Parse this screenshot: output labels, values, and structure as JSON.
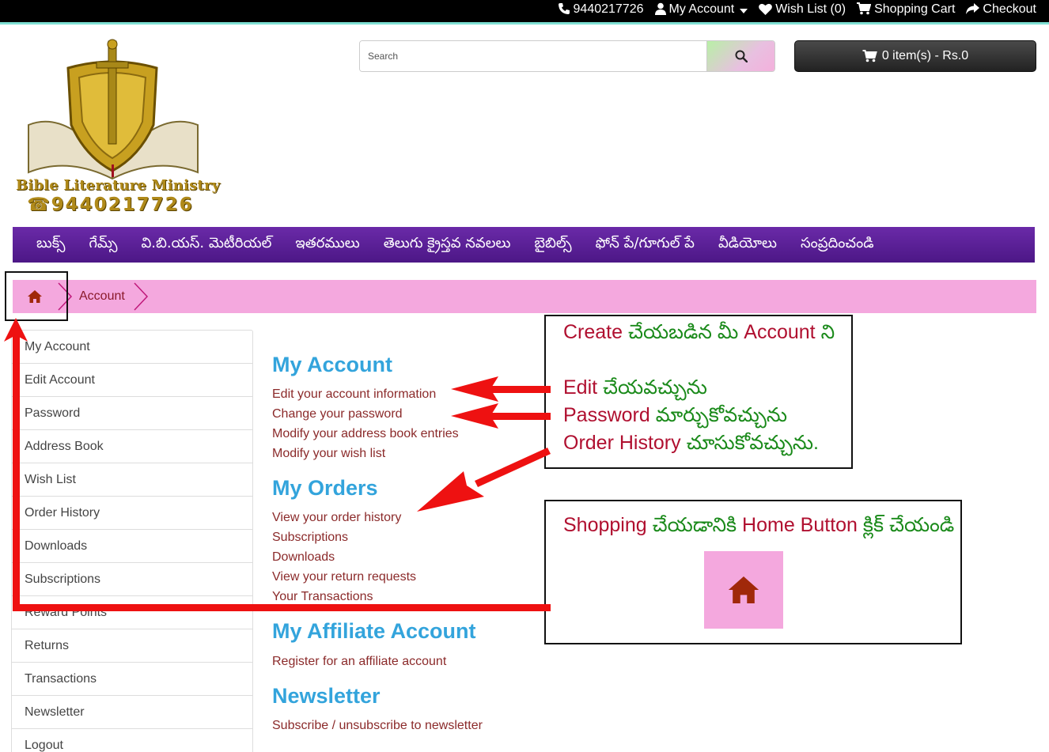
{
  "topbar": {
    "phone": "9440217726",
    "my_account": "My Account",
    "wish_list": "Wish List (0)",
    "shopping_cart": "Shopping Cart",
    "checkout": "Checkout"
  },
  "logo": {
    "name": "Bible Literature Ministry",
    "phone": "☎9440217726"
  },
  "search": {
    "placeholder": "Search"
  },
  "cart": {
    "label": "0 item(s) - Rs.0"
  },
  "menu": [
    "బుక్స్",
    "గేమ్స్",
    "వి.బి.యస్. మెటీరియల్",
    "ఇతరములు",
    "తెలుగు క్రైస్తవ నవలలు",
    "బైబిల్స్",
    "ఫోన్ పే/గూగుల్ పే",
    "వీడియోలు",
    "సంప్రదించండి"
  ],
  "breadcrumb": {
    "current": "Account"
  },
  "sidebar": [
    "My Account",
    "Edit Account",
    "Password",
    "Address Book",
    "Wish List",
    "Order History",
    "Downloads",
    "Subscriptions",
    "Reward Points",
    "Returns",
    "Transactions",
    "Newsletter",
    "Logout"
  ],
  "content": {
    "my_account": {
      "title": "My Account",
      "links": [
        "Edit your account information",
        "Change your password",
        "Modify your address book entries",
        "Modify your wish list"
      ]
    },
    "my_orders": {
      "title": "My Orders",
      "links": [
        "View your order history",
        "Subscriptions",
        "Downloads",
        "View your return requests",
        "Your Transactions"
      ]
    },
    "affiliate": {
      "title": "My Affiliate Account",
      "links": [
        "Register for an affiliate account"
      ]
    },
    "newsletter": {
      "title": "Newsletter",
      "links": [
        "Subscribe / unsubscribe to newsletter"
      ]
    }
  },
  "note1": {
    "l1a": "Create",
    "l1b": " చేయబడిన మీ ",
    "l1c": "Account",
    "l1d": " ని",
    "l2a": "Edit",
    "l2b": " చేయవచ్చును",
    "l3a": "Password",
    "l3b": " మార్చుకోవచ్చును",
    "l4a": "Order History",
    "l4b": " చూసుకోవచ్చును."
  },
  "note2": {
    "a": "Shopping",
    "b": " చేయడానికి ",
    "c": "Home Button",
    "d": " క్లిక్ చేయండి"
  },
  "colors": {
    "menu": "#5a1f96",
    "breadcrumb": "#f4a8de",
    "section_title": "#33a4dc",
    "link": "#8b2a2a",
    "arrow": "#ee1111"
  }
}
